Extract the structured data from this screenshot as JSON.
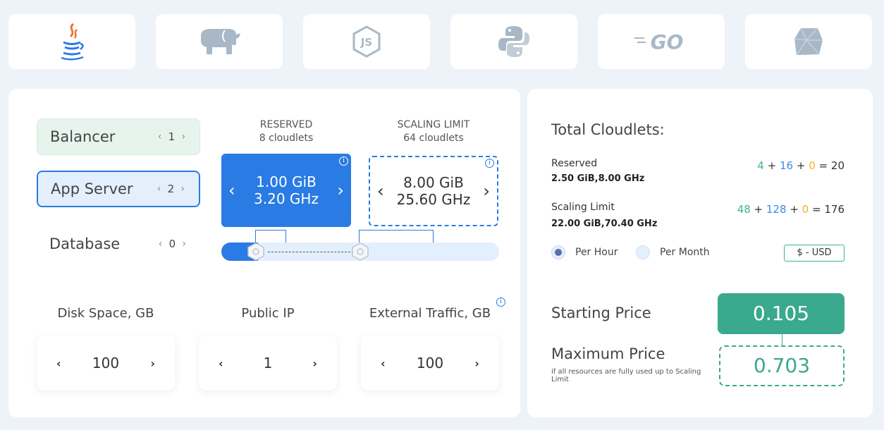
{
  "tabs": [
    {
      "name": "java-icon"
    },
    {
      "name": "php-icon"
    },
    {
      "name": "nodejs-icon",
      "text": "JS"
    },
    {
      "name": "python-icon"
    },
    {
      "name": "go-icon",
      "text": "GO"
    },
    {
      "name": "ruby-icon"
    }
  ],
  "nodes": {
    "balancer": {
      "label": "Balancer",
      "count": "1"
    },
    "app": {
      "label": "App Server",
      "count": "2"
    },
    "db": {
      "label": "Database",
      "count": "0"
    }
  },
  "arrows": {
    "left_small": "‹",
    "right_small": "›",
    "left": "‹",
    "right": "›"
  },
  "reserved": {
    "title": "RESERVED",
    "subtitle": "8 cloudlets",
    "ram": "1.00 GiB",
    "cpu": "3.20 GHz"
  },
  "scaling": {
    "title": "SCALING LIMIT",
    "subtitle": "64 cloudlets",
    "ram": "8.00 GiB",
    "cpu": "25.60 GHz"
  },
  "info_glyph": "i",
  "options": {
    "disk": {
      "label": "Disk Space, GB",
      "value": "100"
    },
    "ip": {
      "label": "Public IP",
      "value": "1"
    },
    "traffic": {
      "label": "External Traffic, GB",
      "value": "100"
    }
  },
  "summary": {
    "title": "Total Cloudlets:",
    "reserved": {
      "label": "Reserved",
      "specs": "2.50 GiB,8.00 GHz",
      "a": "4",
      "b": "16",
      "c": "0",
      "total": "20"
    },
    "scaling": {
      "label": "Scaling Limit",
      "specs": "22.00 GiB,70.40 GHz",
      "a": "48",
      "b": "128",
      "c": "0",
      "total": "176"
    },
    "plus": "+",
    "equals": "=",
    "per_hour": "Per Hour",
    "per_month": "Per Month",
    "currency": "$ - USD",
    "starting_label": "Starting Price",
    "starting_value": "0.105",
    "max_label": "Maximum Price",
    "max_note": "if all resources are fully used up to Scaling Limit",
    "max_value": "0.703"
  },
  "colors": {
    "accent": "#2a7be4",
    "green": "#3aa98e",
    "orange": "#f0b429"
  }
}
